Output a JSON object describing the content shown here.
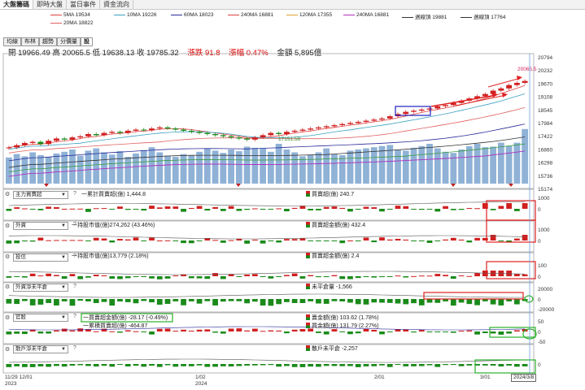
{
  "tabs": [
    "大盤籌碼",
    "即時大盤",
    "當日事件",
    "資金流向"
  ],
  "legend": [
    {
      "label": "5MA 19534",
      "color": "#e04040"
    },
    {
      "label": "10MA 19226",
      "color": "#3aa0c0"
    },
    {
      "label": "60MA 18023",
      "color": "#2a2a9a"
    },
    {
      "label": "240MA 16881",
      "color": "#e04040"
    },
    {
      "label": "120MA 17355",
      "color": "#e0a030"
    },
    {
      "label": "240MA 16881",
      "color": "#b030c0"
    },
    {
      "label": "週線頂 19881",
      "color": "#333333"
    },
    {
      "label": "週線頂 17764",
      "color": "#333333"
    },
    {
      "label": "20MA 18822",
      "color": "#e06060"
    }
  ],
  "subtabs": [
    "均線",
    "布林",
    "趨勢",
    "分價量",
    "設"
  ],
  "ohlc": {
    "open": "開 19966.49",
    "high": "高 20065.5",
    "low": "低 19638.13",
    "close": "收 19785.32",
    "change": "漲跌 91.8",
    "pct": "漲幅 0.47%",
    "amount": "金額 5,895億"
  },
  "price_axis": [
    "20794",
    "20232",
    "19670",
    "19108",
    "18545",
    "17984",
    "17422",
    "16860",
    "16298",
    "15736",
    "15174"
  ],
  "annotations": {
    "high_marker": "20065.5",
    "low_marker": "17151.58"
  },
  "panels": [
    {
      "select": "主力買賣超",
      "left": "一累計買賣超(億) 1,444.8",
      "right": "買賣超(億) 240.7",
      "axis": [
        "1000",
        "0"
      ]
    },
    {
      "select": "外資",
      "left": "一持股市值(億)274,262 (43.46%)",
      "right": "買賣超金額(億) 432.4",
      "axis": [
        "1000",
        "0"
      ]
    },
    {
      "select": "投信",
      "left": "一持股市值(億)13,779 (2.18%)",
      "right": "買賣超金額(億) 2.4",
      "axis": [
        "100",
        "0"
      ]
    },
    {
      "select": "外資淨未平倉",
      "left": "",
      "right": "未平倉量 -1,566",
      "axis": [
        "20000",
        "0",
        "-20000"
      ]
    },
    {
      "select": "官股",
      "left": "一買賣超金額(億) -28.17 (-0.49%)",
      "left2": "一累積買賣超(億) -464.87",
      "right": "賣金額(億) 103.62 (1.78%)",
      "right2": "買金額(億) 131.79 (2.27%)",
      "axis": [
        "50",
        "0",
        "-50"
      ]
    },
    {
      "select": "散戶淨未平倉",
      "left": "",
      "right": "散戶未平倉 -2,257",
      "axis": [
        "0"
      ]
    }
  ],
  "xaxis": [
    {
      "label": "11/29 12/01",
      "sub": "2023"
    },
    {
      "label": "1/02",
      "sub": "2024"
    },
    {
      "label": "2/01",
      "sub": ""
    },
    {
      "label": "3/01",
      "sub": ""
    }
  ],
  "date_cursor": "2024/3/8",
  "chart_data": {
    "type": "bar",
    "price_range": [
      15174,
      20794
    ],
    "closes": [
      16800,
      16900,
      17000,
      17050,
      16950,
      17100,
      17200,
      17150,
      17250,
      17300,
      17400,
      17350,
      17450,
      17500,
      17450,
      17550,
      17600,
      17580,
      17650,
      17700,
      17650,
      17600,
      17550,
      17500,
      17450,
      17400,
      17350,
      17300,
      17250,
      17200,
      17151,
      17250,
      17350,
      17450,
      17400,
      17500,
      17550,
      17600,
      17650,
      17700,
      17750,
      17800,
      17850,
      17900,
      17950,
      18000,
      18050,
      18100,
      18200,
      18300,
      18400,
      18450,
      18500,
      18550,
      18650,
      18700,
      18800,
      18900,
      19000,
      19100,
      19200,
      19350,
      19450,
      19600,
      19700,
      19785
    ],
    "volume": [
      0.46,
      0.52,
      0.48,
      0.55,
      0.5,
      0.47,
      0.53,
      0.56,
      0.6,
      0.49,
      0.58,
      0.62,
      0.55,
      0.51,
      0.57,
      0.47,
      0.53,
      0.59,
      0.64,
      0.55,
      0.49,
      0.47,
      0.52,
      0.5,
      0.56,
      0.62,
      0.58,
      0.54,
      0.6,
      0.57,
      0.65,
      0.63,
      0.62,
      0.56,
      0.7,
      0.6,
      0.55,
      0.48,
      0.5,
      0.55,
      0.62,
      0.52,
      0.5,
      0.58,
      0.6,
      0.62,
      0.64,
      0.66,
      0.68,
      0.6,
      0.58,
      0.63,
      0.66,
      0.7,
      0.62,
      0.56,
      0.54,
      0.6,
      0.66,
      0.7,
      0.64,
      0.65,
      0.72,
      0.66,
      0.72,
      0.96
    ]
  }
}
